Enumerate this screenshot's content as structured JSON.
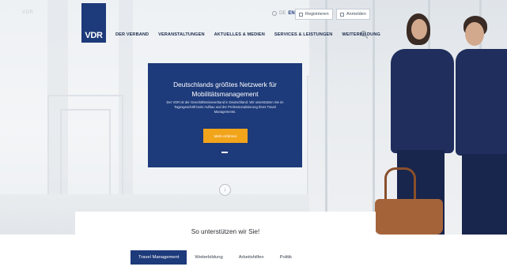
{
  "header": {
    "brand_faint": "VDR",
    "lang": {
      "de": "DE",
      "en": "EN"
    },
    "register_label": "Registrieren",
    "login_label": "Anmelden",
    "logo_text": "VDR"
  },
  "nav": {
    "items": [
      "DER VERBAND",
      "VERANSTALTUNGEN",
      "AKTUELLES & MEDIEN",
      "SERVICES & LEISTUNGEN",
      "WEITERBILDUNG"
    ]
  },
  "hero": {
    "title_line1": "Deutschlands größtes Netzwerk für",
    "title_line2": "Mobilitätsmanagement",
    "description": "Der VDR ist der Geschäftsreiseverband in Deutschland. Wir unterstützen Sie im Tagesgeschäft beim Aufbau und der Professionalisierung Ihres Travel Managements.",
    "cta_label": "Mehr erfahren",
    "scroll_arrow": "↓"
  },
  "section": {
    "title": "So unterstützen wir Sie!",
    "tabs": [
      "Travel Management",
      "Weiterbildung",
      "Arbeitshilfen",
      "Politik"
    ]
  },
  "colors": {
    "brand_blue": "#1d3a7a",
    "cta_orange": "#f2a41b"
  }
}
